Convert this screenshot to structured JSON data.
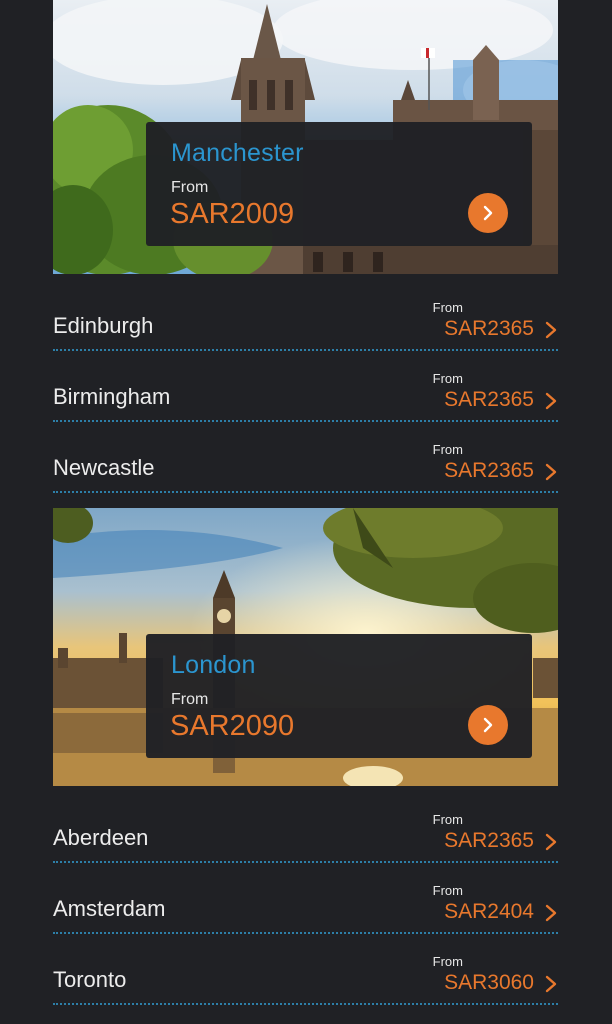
{
  "featured": [
    {
      "city": "Manchester",
      "from_label": "From",
      "price": "SAR2009",
      "icon": "chevron-right-icon"
    },
    {
      "city": "London",
      "from_label": "From",
      "price": "SAR2090",
      "icon": "chevron-right-icon"
    }
  ],
  "destinations_a": [
    {
      "city": "Edinburgh",
      "from_label": "From",
      "price": "SAR2365"
    },
    {
      "city": "Birmingham",
      "from_label": "From",
      "price": "SAR2365"
    },
    {
      "city": "Newcastle",
      "from_label": "From",
      "price": "SAR2365"
    }
  ],
  "destinations_b": [
    {
      "city": "Aberdeen",
      "from_label": "From",
      "price": "SAR2365"
    },
    {
      "city": "Amsterdam",
      "from_label": "From",
      "price": "SAR2404"
    },
    {
      "city": "Toronto",
      "from_label": "From",
      "price": "SAR3060"
    }
  ],
  "colors": {
    "background": "#202125",
    "city_blue": "#2b95cf",
    "price_orange": "#e8782d",
    "divider": "#2d7fa8"
  }
}
